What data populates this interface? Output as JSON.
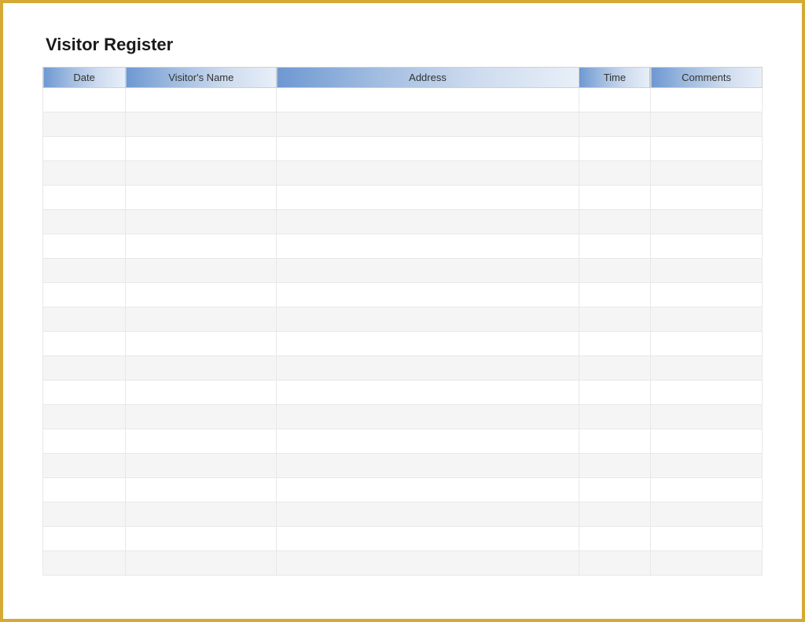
{
  "title": "Visitor Register",
  "columns": {
    "date": "Date",
    "name": "Visitor's Name",
    "address": "Address",
    "time": "Time",
    "comments": "Comments"
  },
  "row_count": 20
}
